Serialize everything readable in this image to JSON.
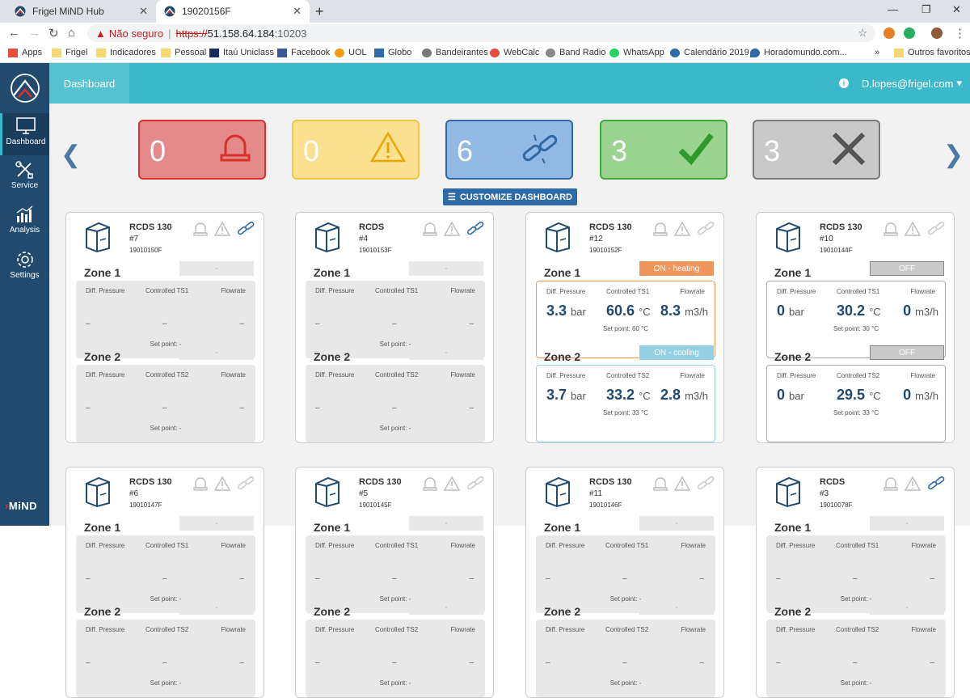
{
  "browser": {
    "tabs": [
      {
        "title": "Frigel MiND Hub"
      },
      {
        "title": "19020156F"
      }
    ],
    "address": {
      "warning": "Não seguro",
      "scheme": "https://",
      "host": "51.158.64.184",
      "port": ":10203"
    },
    "bookmarks": [
      "Apps",
      "Frigel",
      "Indicadores",
      "Pessoal",
      "Itaú Uniclass",
      "Facebook",
      "UOL",
      "Globo",
      "Bandeirantes",
      "WebCalc",
      "Band Radio",
      "WhatsApp",
      "Calendário 2019",
      "Horadomundo.com...",
      "Outros favoritos"
    ],
    "bookmarks_more": "»"
  },
  "sidebar": {
    "items": [
      {
        "label": "Dashboard"
      },
      {
        "label": "Service"
      },
      {
        "label": "Analysis"
      },
      {
        "label": "Settings"
      }
    ],
    "brand": "MiND",
    "brand_mark": "›"
  },
  "topbar": {
    "tab": "Dashboard",
    "user": "D.lopes@frigel.com",
    "user_caret": "▾"
  },
  "nav": {
    "prev": "❮",
    "next": "❯"
  },
  "summary": [
    {
      "count": "0",
      "icon": "alarm-icon",
      "bg": "#e48a8a",
      "border": "#d9302c"
    },
    {
      "count": "0",
      "icon": "warning-icon",
      "bg": "#fbe08f",
      "border": "#f2c744"
    },
    {
      "count": "6",
      "icon": "disconnected-icon",
      "bg": "#92b9e4",
      "border": "#2e6aa6"
    },
    {
      "count": "3",
      "icon": "ok-check-icon",
      "bg": "#9bd48f",
      "border": "#3faa3a"
    },
    {
      "count": "3",
      "icon": "offline-x-icon",
      "bg": "#c9c9c9",
      "border": "#7a7a7a"
    }
  ],
  "customize_label": "CUSTOMIZE DASHBOARD",
  "labels": {
    "diff_pressure": "Diff. Pressure",
    "ts1": "Controlled TS1",
    "ts2": "Controlled TS2",
    "flowrate": "Flowrate",
    "zone1": "Zone 1",
    "zone2": "Zone 2",
    "dash": "–",
    "setpoint_none": "Set point: -",
    "empty_badge": "-"
  },
  "machines": [
    {
      "name": "RCDS 130",
      "num": "#7",
      "serial": "19010150F"
    },
    {
      "name": "RCDS",
      "num": "#4",
      "serial": "19010153F"
    },
    {
      "name": "RCDS 130",
      "num": "#12",
      "serial": "19010152F",
      "zone1": {
        "status": "ON - heating",
        "pressure": "3.3",
        "pressure_unit": "bar",
        "temp": "60.6",
        "temp_unit": "°C",
        "flow": "8.3",
        "flow_unit": "m3/h",
        "setpoint": "Set point: 60 °C"
      },
      "zone2": {
        "status": "ON - cooling",
        "pressure": "3.7",
        "pressure_unit": "bar",
        "temp": "33.2",
        "temp_unit": "°C",
        "flow": "2.8",
        "flow_unit": "m3/h",
        "setpoint": "Set point: 33 °C"
      }
    },
    {
      "name": "RCDS 130",
      "num": "#10",
      "serial": "19010144F",
      "zone1": {
        "status": "OFF",
        "pressure": "0",
        "pressure_unit": "bar",
        "temp": "30.2",
        "temp_unit": "°C",
        "flow": "0",
        "flow_unit": "m3/h",
        "setpoint": "Set point: 30 °C"
      },
      "zone2": {
        "status": "OFF",
        "pressure": "0",
        "pressure_unit": "bar",
        "temp": "29.5",
        "temp_unit": "°C",
        "flow": "0",
        "flow_unit": "m3/h",
        "setpoint": "Set point: 33 °C"
      }
    },
    {
      "name": "RCDS 130",
      "num": "#6",
      "serial": "19010147F"
    },
    {
      "name": "RCDS 130",
      "num": "#5",
      "serial": "19010145F"
    },
    {
      "name": "RCDS 130",
      "num": "#11",
      "serial": "19010146F"
    },
    {
      "name": "RCDS",
      "num": "#3",
      "serial": "19010078F"
    }
  ]
}
